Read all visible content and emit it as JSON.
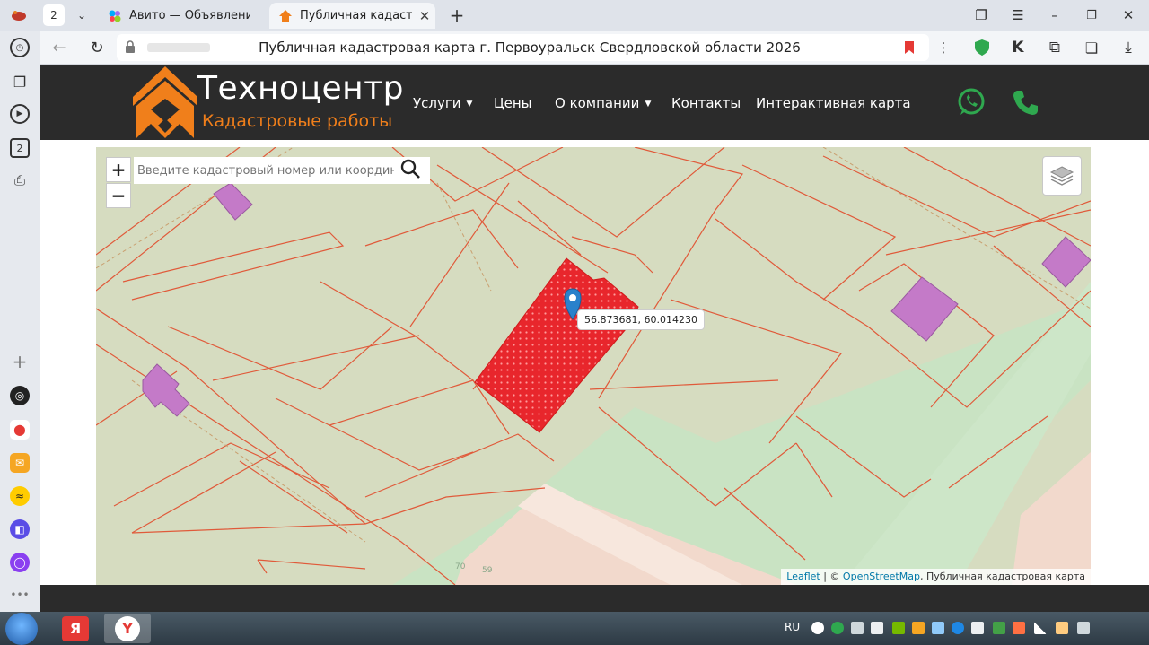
{
  "browser": {
    "tab_counter": "2",
    "tabs": [
      {
        "title": "Авито — Объявления на с",
        "active": false
      },
      {
        "title": "Публичная кадастрова",
        "active": true
      }
    ],
    "address_title": "Публичная кадастровая карта г. Первоуральск Свердловской области 2026",
    "sidebar_badge": "2"
  },
  "site": {
    "logo_title": "Техноцентр",
    "logo_subtitle": "Кадастровые работы",
    "nav": [
      {
        "label": "Услуги",
        "has_dropdown": true
      },
      {
        "label": "Цены",
        "has_dropdown": false
      },
      {
        "label": "О компании",
        "has_dropdown": true
      },
      {
        "label": "Контакты",
        "has_dropdown": false
      },
      {
        "label": "Интерактивная карта",
        "has_dropdown": false
      }
    ],
    "accent_color": "#f07f1b",
    "contact_icons": [
      "whatsapp-icon",
      "phone-icon"
    ],
    "contact_color": "#2fa84f"
  },
  "map": {
    "zoom_in": "+",
    "zoom_out": "−",
    "search_placeholder": "Введите кадастровый номер или координаты",
    "marker_coords": "56.873681, 60.014230",
    "attribution": {
      "leaflet": "Leaflet",
      "separator": "| ©",
      "osm": "OpenStreetMap",
      "rest": ", Публичная кадастровая карта"
    },
    "colors": {
      "land": "#d6dcc0",
      "parcel_border": "#e05a3a",
      "building": "#c47ac8",
      "selected_parcel": "#e8262c",
      "forest": "#c9e3c3",
      "road": "#f2d9cc"
    }
  },
  "taskbar": {
    "language": "RU",
    "apps": [
      "Яндекс",
      "Yandex Browser"
    ]
  }
}
